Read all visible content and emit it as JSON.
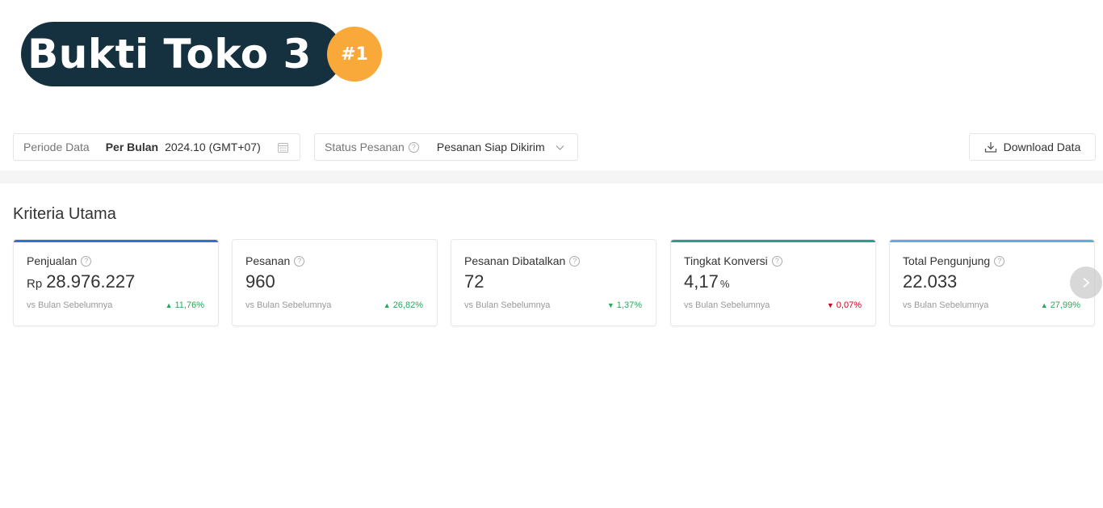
{
  "banner": {
    "title": "Bukti Toko 3",
    "badge": "#1"
  },
  "filters": {
    "period": {
      "label": "Periode Data",
      "mode": "Per Bulan",
      "value": "2024.10 (GMT+07)",
      "icon": "calendar-icon"
    },
    "status": {
      "label": "Status Pesanan",
      "help_icon": "?",
      "value": "Pesanan Siap Dikirim",
      "icon": "chevron-down-icon"
    },
    "download": {
      "label": "Download Data",
      "icon": "download-icon"
    }
  },
  "section": {
    "title": "Kriteria Utama"
  },
  "cards": [
    {
      "name": "Penjualan",
      "prefix": "Rp",
      "value": "28.976.227",
      "suffix": "",
      "compare": "vs Bulan Sebelumnya",
      "direction": "up",
      "change": "11,76%",
      "accent": "#2f6fd6"
    },
    {
      "name": "Pesanan",
      "prefix": "",
      "value": "960",
      "suffix": "",
      "compare": "vs Bulan Sebelumnya",
      "direction": "up",
      "change": "26,82%",
      "accent": ""
    },
    {
      "name": "Pesanan Dibatalkan",
      "prefix": "",
      "value": "72",
      "suffix": "",
      "compare": "vs Bulan Sebelumnya",
      "direction": "down",
      "change": "1,37%",
      "accent": ""
    },
    {
      "name": "Tingkat Konversi",
      "prefix": "",
      "value": "4,17",
      "suffix": "%",
      "compare": "vs Bulan Sebelumnya",
      "direction": "down",
      "change": "0,07%",
      "accent": "#2a9d8f"
    },
    {
      "name": "Total Pengunjung",
      "prefix": "",
      "value": "22.033",
      "suffix": "",
      "compare": "vs Bulan Sebelumnya",
      "direction": "up",
      "change": "27,99%",
      "accent": "#5aaee0"
    }
  ],
  "colors": {
    "up": "#26aa5a",
    "down_good": "#26aa5a",
    "down_bad": "#d0011b",
    "banner_bg": "#15303f",
    "badge_bg": "#f9a93a"
  },
  "glyphs": {
    "up": "▲",
    "down": "▼",
    "help": "?"
  }
}
